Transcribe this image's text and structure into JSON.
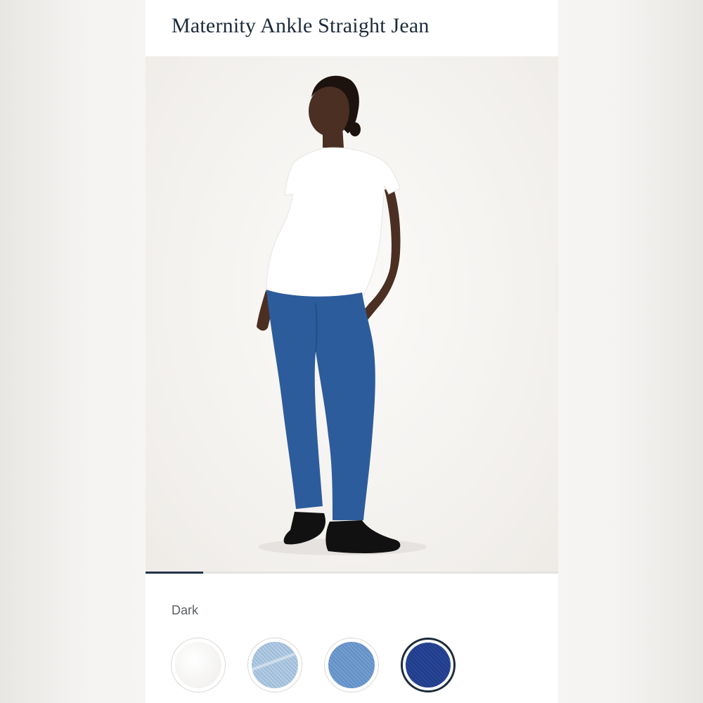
{
  "product": {
    "title": "Maternity Ankle Straight Jean"
  },
  "gallery": {
    "image_description_icon": "model-photo",
    "active_slide_fraction": 0.14
  },
  "color": {
    "selected_label": "Dark",
    "swatches": [
      {
        "id": "white",
        "color": "#f4f3f1",
        "selected": false
      },
      {
        "id": "light-destroyed",
        "color": "#a9c4de",
        "selected": false
      },
      {
        "id": "medium",
        "color": "#6b97cb",
        "selected": false
      },
      {
        "id": "dark",
        "color": "#243f8f",
        "selected": true
      }
    ]
  }
}
